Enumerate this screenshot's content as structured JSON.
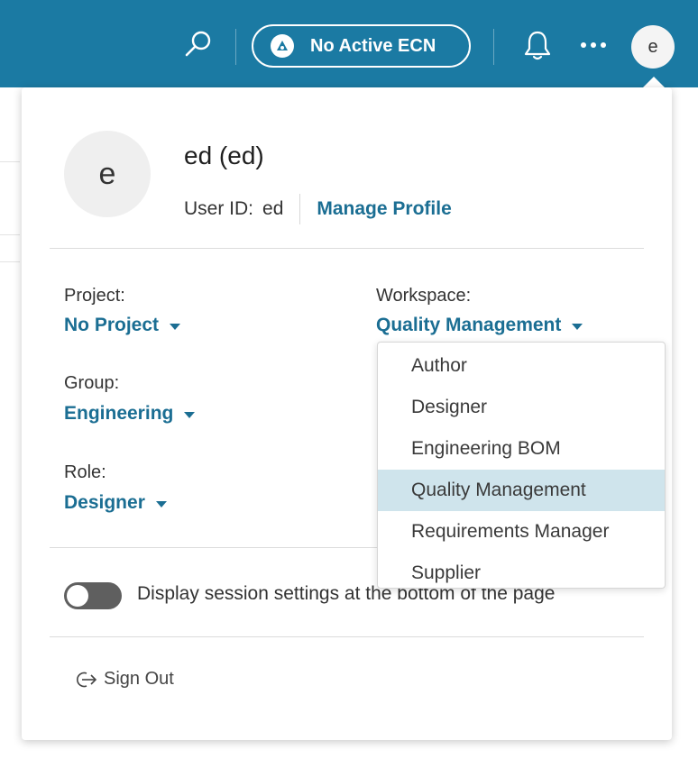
{
  "header": {
    "ecn_label": "No Active ECN",
    "avatar_initial": "e",
    "accent_color": "#1b7aa3",
    "icons": [
      "search-icon",
      "ecn-icon",
      "bell-icon",
      "more-icon"
    ]
  },
  "profile": {
    "avatar_initial": "e",
    "display_name": "ed (ed)",
    "user_id_label": "User ID:",
    "user_id_value": "ed",
    "manage_profile_label": "Manage Profile"
  },
  "session": {
    "project_label": "Project:",
    "project_value": "No Project",
    "workspace_label": "Workspace:",
    "workspace_value": "Quality Management",
    "group_label": "Group:",
    "group_value": "Engineering",
    "role_label": "Role:",
    "role_value": "Designer"
  },
  "toggle": {
    "label": "Display session settings at the bottom of the page",
    "on": false
  },
  "signout_label": "Sign Out",
  "workspace_dropdown": {
    "items": [
      {
        "label": "Author"
      },
      {
        "label": "Designer"
      },
      {
        "label": "Engineering BOM"
      },
      {
        "label": "Quality Management"
      },
      {
        "label": "Requirements Manager"
      },
      {
        "label": "Supplier"
      }
    ],
    "selected": "Quality Management"
  }
}
